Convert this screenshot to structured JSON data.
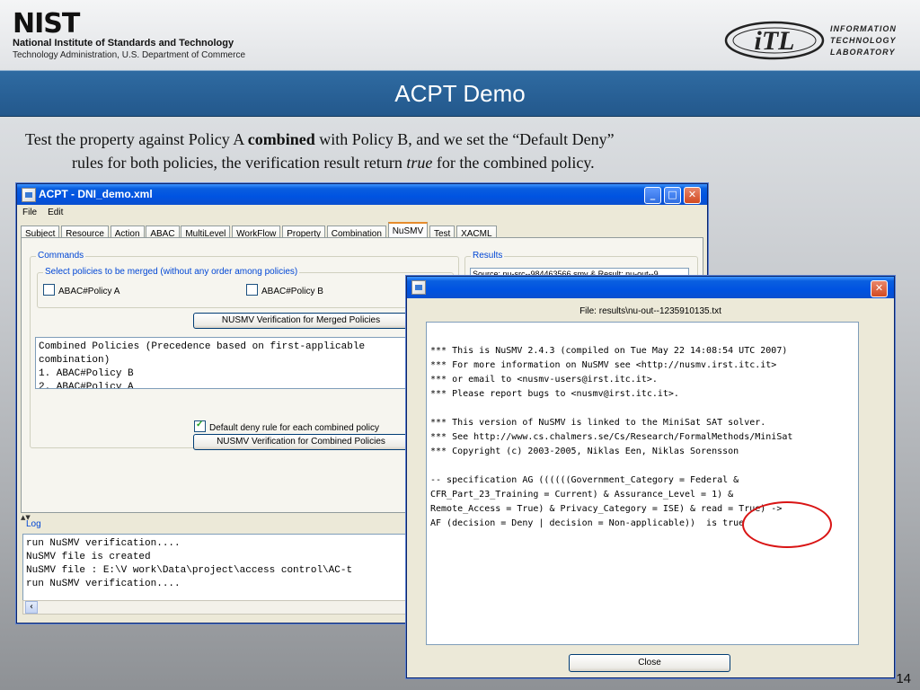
{
  "slide": {
    "org_logo": "NIST",
    "org_name": "National Institute of Standards and Technology",
    "org_dept": "Technology Administration, U.S. Department of Commerce",
    "itl_logo": "iTL",
    "itl_lines": [
      "INFORMATION",
      "TECHNOLOGY",
      "LABORATORY"
    ],
    "title": "ACPT Demo",
    "caption": {
      "p1": "Test the property against Policy A ",
      "p1_bold": "combined",
      "p1_tail": " with Policy B, and we set the “Default Deny”",
      "p2": "rules for both policies, the verification result return ",
      "p2_italic": "true",
      "p2_tail": " for the combined policy."
    },
    "page_number": "14"
  },
  "main_window": {
    "title": "ACPT - DNI_demo.xml",
    "menu": [
      "File",
      "Edit"
    ],
    "tabs": [
      "Subject",
      "Resource",
      "Action",
      "ABAC",
      "MultiLevel",
      "WorkFlow",
      "Property",
      "Combination",
      "NuSMV",
      "Test",
      "XACML"
    ],
    "active_tab": "NuSMV",
    "commands_label": "Commands",
    "merge_group_label": "Select policies to be merged (without any order among policies)",
    "policy_a": "ABAC#Policy A",
    "policy_b": "ABAC#Policy B",
    "verify_merged_button": "NUSMV Verification for Merged Policies",
    "combined_text": "Combined Policies (Precedence based on first-applicable\ncombination)\n1. ABAC#Policy B\n2. ABAC#Policy A",
    "default_deny_label": "Default deny rule for each combined policy",
    "verify_combined_button": "NUSMV Verification for Combined Policies",
    "results_label": "Results",
    "results_value": "Source: nu-src--984463566.smv & Result: nu-out--9",
    "log_label": "Log",
    "log_text": "run NuSMV verification....\nNuSMV file is created\nNuSMV file : E:\\V work\\Data\\project\\access control\\AC-t\nrun NuSMV verification...."
  },
  "dialog": {
    "file_label": "File: results\\nu-out--1235910135.txt",
    "output_text": "*** This is NuSMV 2.4.3 (compiled on Tue May 22 14:08:54 UTC 2007)\n*** For more information on NuSMV see <http://nusmv.irst.itc.it>\n*** or email to <nusmv-users@irst.itc.it>.\n*** Please report bugs to <nusmv@irst.itc.it>.\n\n*** This version of NuSMV is linked to the MiniSat SAT solver.\n*** See http://www.cs.chalmers.se/Cs/Research/FormalMethods/MiniSat\n*** Copyright (c) 2003-2005, Niklas Een, Niklas Sorensson\n\n-- specification AG ((((((Government_Category = Federal &\nCFR_Part_23_Training = Current) & Assurance_Level = 1) &\nRemote_Access = True) & Privacy_Category = ISE) & read = True) ->\nAF (decision = Deny | decision = Non-applicable))  is true",
    "close_button": "Close"
  },
  "colors": {
    "title_bar": "#2a629a",
    "xp_caption": "#0053e1",
    "highlight": "#d91414"
  }
}
